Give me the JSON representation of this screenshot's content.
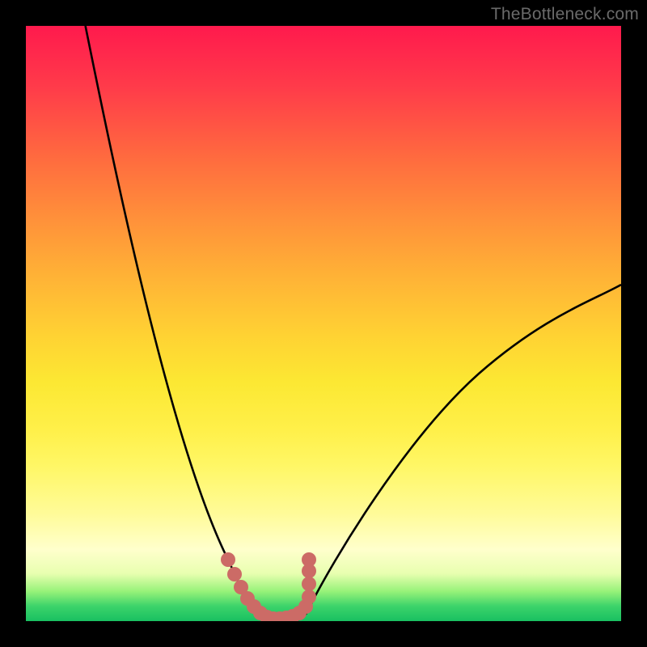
{
  "watermark": "TheBottleneck.com",
  "chart_data": {
    "type": "line",
    "title": "",
    "xlabel": "",
    "ylabel": "",
    "xlim": [
      0,
      100
    ],
    "ylim": [
      0,
      100
    ],
    "series": [
      {
        "name": "bottleneck-curve",
        "x": [
          10,
          15,
          20,
          25,
          30,
          34,
          36,
          38,
          40,
          42,
          44,
          46,
          50,
          55,
          60,
          65,
          70,
          75,
          80,
          85,
          90,
          95,
          100
        ],
        "y": [
          100,
          82,
          64,
          47,
          30,
          14,
          7,
          2,
          0,
          0,
          0,
          2,
          8,
          17,
          25,
          32,
          38,
          43,
          47,
          50,
          53,
          55,
          57
        ]
      },
      {
        "name": "highlight-dots",
        "x": [
          34,
          35,
          36,
          37,
          38,
          39,
          40,
          41,
          42,
          43,
          44,
          45,
          46,
          47
        ],
        "y": [
          14,
          10,
          7,
          4,
          2,
          1,
          0,
          0,
          0,
          0,
          0,
          1,
          2,
          4
        ]
      }
    ],
    "background_gradient": {
      "top": "#ff1a4d",
      "quarter": "#ff8f3a",
      "mid": "#fce833",
      "lower": "#ffffcc",
      "bottom": "#19c061"
    }
  }
}
